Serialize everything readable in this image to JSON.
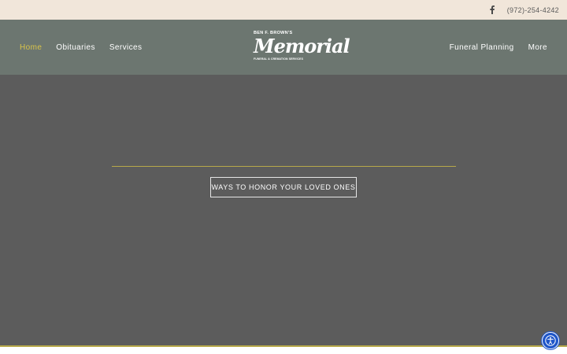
{
  "topbar": {
    "facebook_icon": "facebook-icon",
    "phone": "(972)-254-4242"
  },
  "nav": {
    "left": [
      {
        "label": "Home",
        "active": true
      },
      {
        "label": "Obituaries",
        "active": false
      },
      {
        "label": "Services",
        "active": false
      }
    ],
    "right": [
      {
        "label": "Funeral Planning",
        "active": false
      },
      {
        "label": "More",
        "active": false
      }
    ]
  },
  "logo": {
    "top": "BEN F. BROWN'S",
    "main": "Memorial",
    "sub": "FUNERAL & CREMATION SERVICES"
  },
  "hero": {
    "button_label": "WAYS TO HONOR YOUR LOVED ONES"
  },
  "accessibility": {
    "icon": "accessibility-icon"
  },
  "colors": {
    "topbar_bg": "#f1e6da",
    "nav_bg": "#6c7670",
    "active_nav": "#d8c34a",
    "hero_bg": "#5c5c5c",
    "accent_line": "#b7a94a",
    "a11y_button": "#1f56c9"
  }
}
